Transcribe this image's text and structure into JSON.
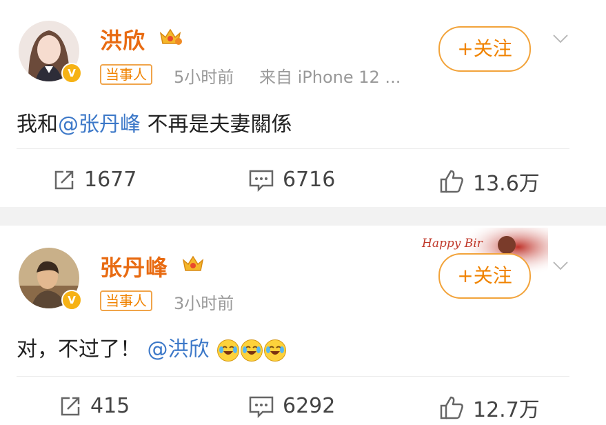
{
  "posts": [
    {
      "username": "洪欣",
      "tag": "当事人",
      "time": "5小时前",
      "source": "来自 iPhone 12 ...",
      "follow_label": "+关注",
      "text_before": "我和",
      "mention": "@张丹峰",
      "text_after": " 不再是夫妻關係",
      "reposts": "1677",
      "comments": "6716",
      "likes": "13.6万"
    },
    {
      "username": "张丹峰",
      "tag": "当事人",
      "time": "3小时前",
      "follow_label": "+关注",
      "text_before": "对，不过了！",
      "mention": "@洪欣",
      "reposts": "415",
      "comments": "6292",
      "likes": "12.7万",
      "banner_text": "Happy Bir"
    }
  ],
  "icons": {
    "verified": "verified-badge-icon",
    "crown": "vip-crown-icon",
    "repost": "repost-icon",
    "comment": "comment-icon",
    "like": "thumbs-up-icon",
    "menu": "chevron-down-icon",
    "emoji": "laugh-cry-emoji-icon"
  },
  "colors": {
    "username": "#e86b12",
    "mention": "#3c78c8",
    "follow": "#f08300"
  }
}
